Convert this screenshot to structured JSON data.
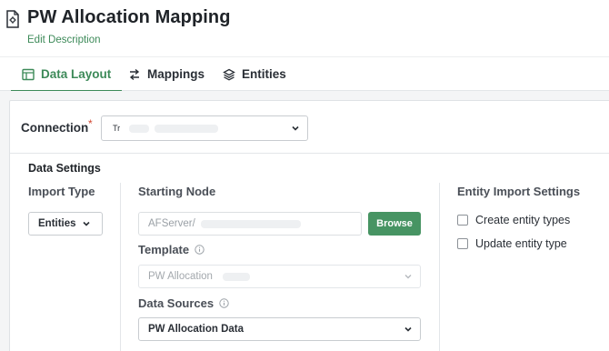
{
  "header": {
    "title": "PW Allocation Mapping",
    "edit_description": "Edit Description",
    "icon": "document-settings-icon"
  },
  "tabs": [
    {
      "label": "Data Layout",
      "icon": "table-icon",
      "active": true
    },
    {
      "label": "Mappings",
      "icon": "mapping-arrows-icon",
      "active": false
    },
    {
      "label": "Entities",
      "icon": "layers-icon",
      "active": false
    }
  ],
  "connection": {
    "label": "Connection",
    "required_mark": "*",
    "value": "Tr"
  },
  "data_settings": {
    "title": "Data Settings",
    "import_type": {
      "label": "Import Type",
      "value": "Entities"
    },
    "starting_node": {
      "label": "Starting Node",
      "value": "AFServer/",
      "browse_label": "Browse"
    },
    "template": {
      "label": "Template",
      "value": "PW Allocation"
    },
    "data_sources": {
      "label": "Data Sources",
      "value": "PW Allocation Data"
    },
    "entity_import": {
      "label": "Entity Import Settings",
      "options": [
        {
          "label": "Create entity types",
          "checked": false
        },
        {
          "label": "Update entity type",
          "checked": false
        }
      ]
    }
  },
  "colors": {
    "accent": "#3d8a59",
    "browse_button": "#479463",
    "required": "#d2452f"
  }
}
